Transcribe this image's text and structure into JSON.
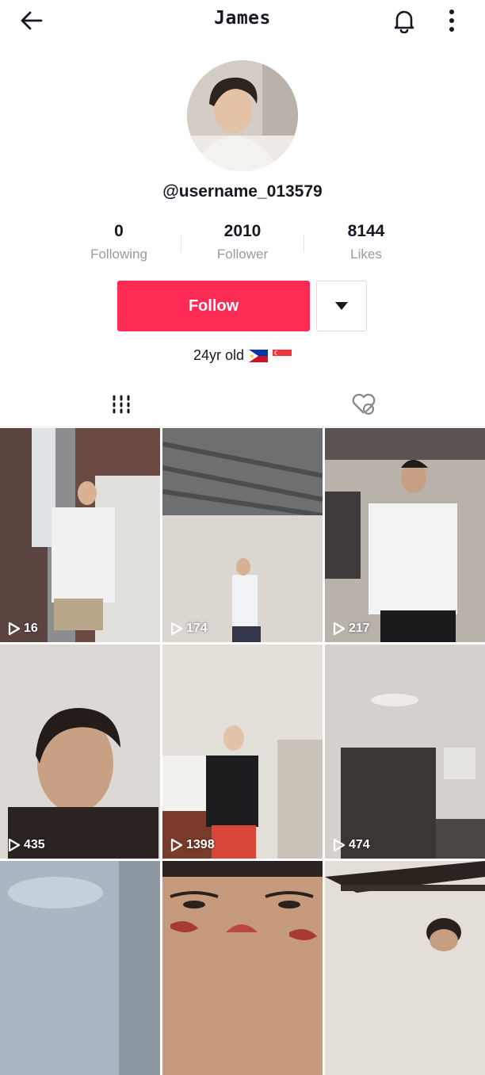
{
  "header": {
    "title": "James",
    "back_icon": "arrow-left-icon",
    "bell_icon": "bell-icon",
    "more_icon": "more-vertical-icon"
  },
  "profile": {
    "username": "@username_013579",
    "stats": [
      {
        "value": "0",
        "label": "Following"
      },
      {
        "value": "2010",
        "label": "Follower"
      },
      {
        "value": "8144",
        "label": "Likes"
      }
    ],
    "follow_label": "Follow",
    "bio": "24yr old",
    "bio_flags": [
      "flag-philippines",
      "flag-singapore"
    ]
  },
  "tabs": [
    {
      "name": "videos",
      "icon": "grid-icon",
      "active": true
    },
    {
      "name": "liked",
      "icon": "hidden-heart-icon",
      "active": false
    }
  ],
  "videos": [
    {
      "views": "16"
    },
    {
      "views": "174"
    },
    {
      "views": "217"
    },
    {
      "views": "435"
    },
    {
      "views": "1398"
    },
    {
      "views": "474"
    },
    {
      "views": ""
    },
    {
      "views": ""
    },
    {
      "views": ""
    }
  ],
  "colors": {
    "accent": "#fe2c55",
    "text": "#161823",
    "muted": "#9a9aa0"
  }
}
